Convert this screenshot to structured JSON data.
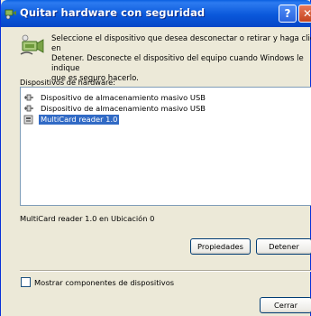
{
  "window": {
    "title": "Quitar hardware con seguridad",
    "help_label": "?",
    "close_label": "✕"
  },
  "intro": {
    "icon": "safely-remove-hardware-icon",
    "text": "Seleccione el dispositivo que desea desconectar o retirar y haga clic en\nDetener. Desconecte el dispositivo del equipo cuando Windows le indique\nque es seguro hacerlo."
  },
  "devices": {
    "label": "Dispositivos de hardware:",
    "items": [
      {
        "label": "Dispositivo de almacenamiento masivo USB",
        "icon": "usb-plug-icon",
        "selected": false
      },
      {
        "label": "Dispositivo de almacenamiento masivo USB",
        "icon": "usb-plug-icon",
        "selected": false
      },
      {
        "label": "MultiCard reader 1.0",
        "icon": "card-reader-icon",
        "selected": true
      }
    ]
  },
  "status": "MultiCard reader 1.0 en Ubicación 0",
  "buttons": {
    "properties": "Propiedades",
    "stop": "Detener",
    "close": "Cerrar"
  },
  "show_components": {
    "label": "Mostrar componentes de dispositivos",
    "checked": false
  },
  "colors": {
    "titlebar": "#0a58db",
    "selection": "#316ac5",
    "dialog_bg": "#ece9d8"
  }
}
